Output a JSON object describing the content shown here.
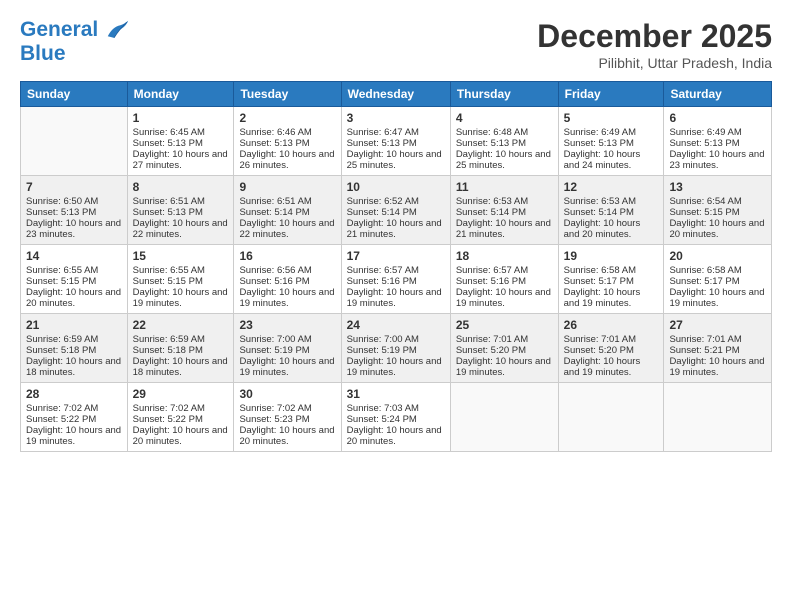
{
  "logo": {
    "line1": "General",
    "line2": "Blue"
  },
  "header": {
    "month": "December 2025",
    "location": "Pilibhit, Uttar Pradesh, India"
  },
  "weekdays": [
    "Sunday",
    "Monday",
    "Tuesday",
    "Wednesday",
    "Thursday",
    "Friday",
    "Saturday"
  ],
  "weeks": [
    [
      {
        "day": null,
        "content": null
      },
      {
        "day": "1",
        "sunrise": "Sunrise: 6:45 AM",
        "sunset": "Sunset: 5:13 PM",
        "daylight": "Daylight: 10 hours and 27 minutes."
      },
      {
        "day": "2",
        "sunrise": "Sunrise: 6:46 AM",
        "sunset": "Sunset: 5:13 PM",
        "daylight": "Daylight: 10 hours and 26 minutes."
      },
      {
        "day": "3",
        "sunrise": "Sunrise: 6:47 AM",
        "sunset": "Sunset: 5:13 PM",
        "daylight": "Daylight: 10 hours and 25 minutes."
      },
      {
        "day": "4",
        "sunrise": "Sunrise: 6:48 AM",
        "sunset": "Sunset: 5:13 PM",
        "daylight": "Daylight: 10 hours and 25 minutes."
      },
      {
        "day": "5",
        "sunrise": "Sunrise: 6:49 AM",
        "sunset": "Sunset: 5:13 PM",
        "daylight": "Daylight: 10 hours and 24 minutes."
      },
      {
        "day": "6",
        "sunrise": "Sunrise: 6:49 AM",
        "sunset": "Sunset: 5:13 PM",
        "daylight": "Daylight: 10 hours and 23 minutes."
      }
    ],
    [
      {
        "day": "7",
        "sunrise": "Sunrise: 6:50 AM",
        "sunset": "Sunset: 5:13 PM",
        "daylight": "Daylight: 10 hours and 23 minutes."
      },
      {
        "day": "8",
        "sunrise": "Sunrise: 6:51 AM",
        "sunset": "Sunset: 5:13 PM",
        "daylight": "Daylight: 10 hours and 22 minutes."
      },
      {
        "day": "9",
        "sunrise": "Sunrise: 6:51 AM",
        "sunset": "Sunset: 5:14 PM",
        "daylight": "Daylight: 10 hours and 22 minutes."
      },
      {
        "day": "10",
        "sunrise": "Sunrise: 6:52 AM",
        "sunset": "Sunset: 5:14 PM",
        "daylight": "Daylight: 10 hours and 21 minutes."
      },
      {
        "day": "11",
        "sunrise": "Sunrise: 6:53 AM",
        "sunset": "Sunset: 5:14 PM",
        "daylight": "Daylight: 10 hours and 21 minutes."
      },
      {
        "day": "12",
        "sunrise": "Sunrise: 6:53 AM",
        "sunset": "Sunset: 5:14 PM",
        "daylight": "Daylight: 10 hours and 20 minutes."
      },
      {
        "day": "13",
        "sunrise": "Sunrise: 6:54 AM",
        "sunset": "Sunset: 5:15 PM",
        "daylight": "Daylight: 10 hours and 20 minutes."
      }
    ],
    [
      {
        "day": "14",
        "sunrise": "Sunrise: 6:55 AM",
        "sunset": "Sunset: 5:15 PM",
        "daylight": "Daylight: 10 hours and 20 minutes."
      },
      {
        "day": "15",
        "sunrise": "Sunrise: 6:55 AM",
        "sunset": "Sunset: 5:15 PM",
        "daylight": "Daylight: 10 hours and 19 minutes."
      },
      {
        "day": "16",
        "sunrise": "Sunrise: 6:56 AM",
        "sunset": "Sunset: 5:16 PM",
        "daylight": "Daylight: 10 hours and 19 minutes."
      },
      {
        "day": "17",
        "sunrise": "Sunrise: 6:57 AM",
        "sunset": "Sunset: 5:16 PM",
        "daylight": "Daylight: 10 hours and 19 minutes."
      },
      {
        "day": "18",
        "sunrise": "Sunrise: 6:57 AM",
        "sunset": "Sunset: 5:16 PM",
        "daylight": "Daylight: 10 hours and 19 minutes."
      },
      {
        "day": "19",
        "sunrise": "Sunrise: 6:58 AM",
        "sunset": "Sunset: 5:17 PM",
        "daylight": "Daylight: 10 hours and 19 minutes."
      },
      {
        "day": "20",
        "sunrise": "Sunrise: 6:58 AM",
        "sunset": "Sunset: 5:17 PM",
        "daylight": "Daylight: 10 hours and 19 minutes."
      }
    ],
    [
      {
        "day": "21",
        "sunrise": "Sunrise: 6:59 AM",
        "sunset": "Sunset: 5:18 PM",
        "daylight": "Daylight: 10 hours and 18 minutes."
      },
      {
        "day": "22",
        "sunrise": "Sunrise: 6:59 AM",
        "sunset": "Sunset: 5:18 PM",
        "daylight": "Daylight: 10 hours and 18 minutes."
      },
      {
        "day": "23",
        "sunrise": "Sunrise: 7:00 AM",
        "sunset": "Sunset: 5:19 PM",
        "daylight": "Daylight: 10 hours and 19 minutes."
      },
      {
        "day": "24",
        "sunrise": "Sunrise: 7:00 AM",
        "sunset": "Sunset: 5:19 PM",
        "daylight": "Daylight: 10 hours and 19 minutes."
      },
      {
        "day": "25",
        "sunrise": "Sunrise: 7:01 AM",
        "sunset": "Sunset: 5:20 PM",
        "daylight": "Daylight: 10 hours and 19 minutes."
      },
      {
        "day": "26",
        "sunrise": "Sunrise: 7:01 AM",
        "sunset": "Sunset: 5:20 PM",
        "daylight": "Daylight: 10 hours and 19 minutes."
      },
      {
        "day": "27",
        "sunrise": "Sunrise: 7:01 AM",
        "sunset": "Sunset: 5:21 PM",
        "daylight": "Daylight: 10 hours and 19 minutes."
      }
    ],
    [
      {
        "day": "28",
        "sunrise": "Sunrise: 7:02 AM",
        "sunset": "Sunset: 5:22 PM",
        "daylight": "Daylight: 10 hours and 19 minutes."
      },
      {
        "day": "29",
        "sunrise": "Sunrise: 7:02 AM",
        "sunset": "Sunset: 5:22 PM",
        "daylight": "Daylight: 10 hours and 20 minutes."
      },
      {
        "day": "30",
        "sunrise": "Sunrise: 7:02 AM",
        "sunset": "Sunset: 5:23 PM",
        "daylight": "Daylight: 10 hours and 20 minutes."
      },
      {
        "day": "31",
        "sunrise": "Sunrise: 7:03 AM",
        "sunset": "Sunset: 5:24 PM",
        "daylight": "Daylight: 10 hours and 20 minutes."
      },
      {
        "day": null,
        "content": null
      },
      {
        "day": null,
        "content": null
      },
      {
        "day": null,
        "content": null
      }
    ]
  ]
}
